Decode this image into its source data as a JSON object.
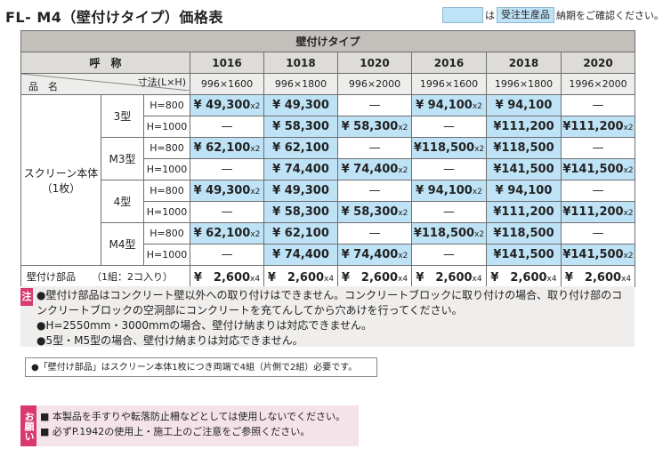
{
  "title": "FL- M4（壁付けタイプ）価格表",
  "legend": {
    "mid": "は",
    "swatch_text": "受注生産品",
    "suffix": "納期をご確認ください。"
  },
  "table": {
    "group_header": "壁付けタイプ",
    "header_label": "呼　称",
    "size_label": "寸法(L×H)",
    "item_label": "品　名",
    "columns": [
      {
        "code": "1016",
        "size": "996×1600"
      },
      {
        "code": "1018",
        "size": "996×1800"
      },
      {
        "code": "1020",
        "size": "996×2000"
      },
      {
        "code": "2016",
        "size": "1996×1600"
      },
      {
        "code": "2018",
        "size": "1996×1800"
      },
      {
        "code": "2020",
        "size": "1996×2000"
      }
    ],
    "product_name": "スクリーン本体",
    "product_qty": "（1枚）",
    "types": [
      "3型",
      "M3型",
      "4型",
      "M4型"
    ],
    "heights": [
      "H=800",
      "H=1000"
    ],
    "rows": [
      [
        [
          "¥ 49,300",
          "x2"
        ],
        [
          "¥ 49,300",
          ""
        ],
        [
          "—",
          ""
        ],
        [
          "¥ 94,100",
          "x2"
        ],
        [
          "¥ 94,100",
          ""
        ],
        [
          "—",
          ""
        ]
      ],
      [
        [
          "—",
          ""
        ],
        [
          "¥ 58,300",
          ""
        ],
        [
          "¥ 58,300",
          "x2"
        ],
        [
          "—",
          ""
        ],
        [
          "¥111,200",
          ""
        ],
        [
          "¥111,200",
          "x2"
        ]
      ],
      [
        [
          "¥ 62,100",
          "x2"
        ],
        [
          "¥ 62,100",
          ""
        ],
        [
          "—",
          ""
        ],
        [
          "¥118,500",
          "x2"
        ],
        [
          "¥118,500",
          ""
        ],
        [
          "—",
          ""
        ]
      ],
      [
        [
          "—",
          ""
        ],
        [
          "¥ 74,400",
          ""
        ],
        [
          "¥ 74,400",
          "x2"
        ],
        [
          "—",
          ""
        ],
        [
          "¥141,500",
          ""
        ],
        [
          "¥141,500",
          "x2"
        ]
      ],
      [
        [
          "¥ 49,300",
          "x2"
        ],
        [
          "¥ 49,300",
          ""
        ],
        [
          "—",
          ""
        ],
        [
          "¥ 94,100",
          "x2"
        ],
        [
          "¥ 94,100",
          ""
        ],
        [
          "—",
          ""
        ]
      ],
      [
        [
          "—",
          ""
        ],
        [
          "¥ 58,300",
          ""
        ],
        [
          "¥ 58,300",
          "x2"
        ],
        [
          "—",
          ""
        ],
        [
          "¥111,200",
          ""
        ],
        [
          "¥111,200",
          "x2"
        ]
      ],
      [
        [
          "¥ 62,100",
          "x2"
        ],
        [
          "¥ 62,100",
          ""
        ],
        [
          "—",
          ""
        ],
        [
          "¥118,500",
          "x2"
        ],
        [
          "¥118,500",
          ""
        ],
        [
          "—",
          ""
        ]
      ],
      [
        [
          "—",
          ""
        ],
        [
          "¥ 74,400",
          ""
        ],
        [
          "¥ 74,400",
          "x2"
        ],
        [
          "—",
          ""
        ],
        [
          "¥141,500",
          ""
        ],
        [
          "¥141,500",
          "x2"
        ]
      ]
    ],
    "parts_label": "壁付け部品",
    "parts_qty": "（1組：2コ入り）",
    "parts_prices": [
      [
        "¥　2,600",
        "x4"
      ],
      [
        "¥　2,600",
        "x4"
      ],
      [
        "¥　2,600",
        "x4"
      ],
      [
        "¥　2,600",
        "x4"
      ],
      [
        "¥　2,600",
        "x4"
      ],
      [
        "¥　2,600",
        "x4"
      ]
    ]
  },
  "notes": {
    "tag": "注",
    "lines": [
      "●壁付け部品はコンクリート壁以外への取り付けはできません。コンクリートブロックに取り付けの場合、取り付け部のコ",
      "ンクリートブロックの空洞部にコンクリートを充てんしてから穴あけを行ってください。",
      "●H=2550mm・3000mmの場合、壁付け納まりは対応できません。",
      "●5型・M5型の場合、壁付け納まりは対応できません。"
    ]
  },
  "sub_note": "●「壁付け部品」はスクリーン本体1枚につき両端で4組（片側で2組）必要です。",
  "warning": {
    "tag": "お願い",
    "lines": [
      "■ 本製品を手すりや転落防止柵などとしては使用しないでください。",
      "■ 必ずP.1942の使用上・施工上のご注意をご参照ください。"
    ]
  }
}
